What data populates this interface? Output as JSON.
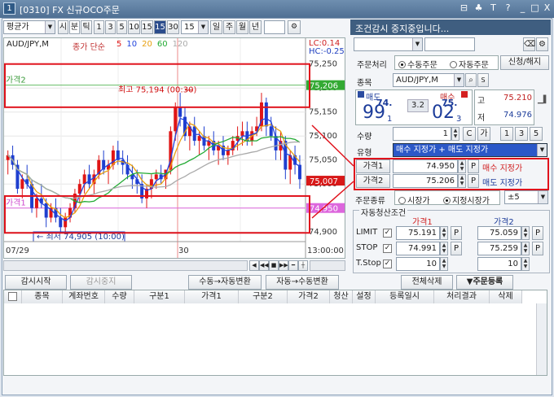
{
  "window": {
    "number": "1",
    "title": "[0310] FX 신규OCO주문",
    "controls": [
      "⊟",
      "♣",
      "T",
      "?",
      "_",
      "□",
      "X"
    ]
  },
  "toolbar": {
    "price_type": "평균가",
    "periods": [
      "시",
      "분",
      "틱",
      "1",
      "3",
      "5",
      "10",
      "15",
      "30"
    ],
    "active_period": "15",
    "period_value": "15",
    "units": [
      "일",
      "주",
      "월",
      "년"
    ]
  },
  "chart": {
    "symbol": "AUD/JPY,M",
    "indicator_label": "종가 단순",
    "ma_periods": [
      {
        "label": "5",
        "color": "#e01515"
      },
      {
        "label": "10",
        "color": "#2244dd"
      },
      {
        "label": "20",
        "color": "#e8a010"
      },
      {
        "label": "60",
        "color": "#22aa33"
      },
      {
        "label": "120",
        "color": "#aaaaaa"
      }
    ],
    "lc": "LC:0.14",
    "hc": "HC:-0.25",
    "y_ticks": [
      "75,250",
      "75,200",
      "75,150",
      "75,100",
      "75,050",
      "75,000",
      "74,950",
      "74,900"
    ],
    "price1_tag": "75,206",
    "current_tag": "75,007",
    "price2_tag": "74,950",
    "price2_line_label": "가격2",
    "price1_line_label": "가격1",
    "high_annotation": "최고 75,194 (00:30)",
    "low_annotation": "최저 74,905 (10:00)",
    "x_labels": [
      "07/29",
      "30",
      "13:00:00"
    ],
    "candles": [
      [
        75.05,
        75.07,
        75.02,
        75.06
      ],
      [
        75.06,
        75.08,
        75.03,
        75.04
      ],
      [
        75.04,
        75.05,
        74.98,
        74.99
      ],
      [
        74.99,
        75.02,
        74.97,
        75.01
      ],
      [
        75.01,
        75.04,
        74.99,
        75.0
      ],
      [
        75.0,
        75.01,
        74.94,
        74.95
      ],
      [
        74.95,
        74.98,
        74.93,
        74.97
      ],
      [
        74.97,
        75.0,
        74.95,
        74.96
      ],
      [
        74.96,
        74.97,
        74.91,
        74.93
      ],
      [
        74.93,
        74.96,
        74.92,
        74.95
      ],
      [
        74.95,
        74.97,
        74.92,
        74.93
      ],
      [
        74.93,
        74.95,
        74.9,
        74.91
      ],
      [
        74.91,
        74.94,
        74.9,
        74.93
      ],
      [
        74.93,
        74.96,
        74.92,
        74.95
      ],
      [
        74.95,
        74.99,
        74.94,
        74.98
      ],
      [
        74.98,
        75.01,
        74.96,
        75.0
      ],
      [
        75.0,
        75.03,
        74.98,
        75.02
      ],
      [
        75.02,
        75.04,
        74.99,
        75.0
      ],
      [
        75.0,
        75.03,
        74.98,
        75.02
      ],
      [
        75.02,
        75.06,
        75.01,
        75.05
      ],
      [
        75.05,
        75.07,
        75.02,
        75.03
      ],
      [
        75.03,
        75.05,
        75.0,
        75.04
      ],
      [
        75.04,
        75.08,
        75.03,
        75.07
      ],
      [
        75.07,
        75.09,
        75.04,
        75.05
      ],
      [
        75.05,
        75.07,
        75.02,
        75.04
      ],
      [
        75.04,
        75.06,
        75.01,
        75.02
      ],
      [
        75.02,
        75.04,
        74.99,
        75.01
      ],
      [
        75.01,
        75.03,
        74.98,
        75.0
      ],
      [
        75.0,
        75.02,
        74.96,
        74.97
      ],
      [
        74.97,
        75.0,
        74.95,
        74.99
      ],
      [
        74.99,
        75.02,
        74.97,
        75.01
      ],
      [
        75.01,
        75.03,
        74.99,
        75.02
      ],
      [
        75.02,
        75.04,
        75.0,
        75.01
      ],
      [
        75.01,
        75.03,
        74.99,
        75.03
      ],
      [
        75.03,
        75.12,
        75.02,
        75.11
      ],
      [
        75.11,
        75.17,
        75.09,
        75.16
      ],
      [
        75.16,
        75.19,
        75.12,
        75.14
      ],
      [
        75.14,
        75.16,
        75.09,
        75.1
      ],
      [
        75.1,
        75.13,
        75.07,
        75.12
      ],
      [
        75.12,
        75.14,
        75.08,
        75.09
      ],
      [
        75.09,
        75.11,
        75.06,
        75.1
      ],
      [
        75.1,
        75.12,
        75.07,
        75.08
      ],
      [
        75.08,
        75.1,
        75.05,
        75.09
      ],
      [
        75.09,
        75.11,
        75.06,
        75.07
      ],
      [
        75.07,
        75.09,
        75.04,
        75.08
      ],
      [
        75.08,
        75.1,
        75.05,
        75.06
      ],
      [
        75.06,
        75.08,
        75.04,
        75.07
      ],
      [
        75.07,
        75.1,
        75.06,
        75.09
      ],
      [
        75.09,
        75.12,
        75.07,
        75.1
      ],
      [
        75.1,
        75.13,
        75.08,
        75.11
      ],
      [
        75.11,
        75.13,
        75.08,
        75.09
      ],
      [
        75.09,
        75.12,
        75.08,
        75.11
      ],
      [
        75.11,
        75.14,
        75.1,
        75.12
      ],
      [
        75.12,
        75.19,
        75.11,
        75.17
      ],
      [
        75.17,
        75.18,
        75.1,
        75.12
      ],
      [
        75.12,
        75.14,
        75.09,
        75.1
      ],
      [
        75.1,
        75.12,
        75.05,
        75.07
      ],
      [
        75.07,
        75.11,
        75.05,
        75.09
      ],
      [
        75.09,
        75.1,
        75.01,
        75.03
      ],
      [
        75.03,
        75.07,
        75.0,
        75.06
      ],
      [
        75.06,
        75.08,
        75.02,
        75.04
      ],
      [
        75.04,
        75.06,
        74.99,
        75.01
      ]
    ]
  },
  "chart_nav": {
    "buttons": [
      "◀",
      "◀◀",
      "■",
      "▶▶",
      "━",
      "┼"
    ]
  },
  "actions": {
    "start_monitor": "감시시작",
    "stop_monitor": "감시중지",
    "manual_to_auto": "수동→자동변환",
    "auto_to_manual": "자동→수동변환",
    "delete_all": "전체삭제",
    "register_order": "▼주문등록"
  },
  "panel": {
    "status": "조건감시 중지중입니다...",
    "order_mode_label": "주문처리",
    "order_modes": [
      "수동주문",
      "자동주문"
    ],
    "order_mode_selected": "수동주문",
    "new_cancel": "신청/해지",
    "symbol_label": "종목",
    "symbol_value": "AUD/JPY,M",
    "sell_label": "매도",
    "buy_label": "매수",
    "sell_prefix": "74.",
    "sell_big": "99",
    "sell_sub": "1",
    "buy_prefix": "75.",
    "buy_big": "02",
    "buy_sub": "3",
    "spread": "3.2",
    "high_label": "고",
    "high_value": "75.210",
    "low_label": "저",
    "low_value": "74.976",
    "qty_label": "수량",
    "qty_value": "1",
    "qty_buttons": [
      "C",
      "가",
      "1",
      "3",
      "5"
    ],
    "type_label": "유형",
    "type_value": "매수 지정가 + 매도 지정가",
    "price1_label": "가격1",
    "price1_value": "74.950",
    "price1_desc": "매수 지정가",
    "price2_label": "가격2",
    "price2_value": "75.206",
    "price2_desc": "매도 지정가",
    "p_button": "P",
    "order_kind_label": "주문종류",
    "order_kinds": [
      "시장가",
      "지정시장가"
    ],
    "order_kind_selected": "지정시장가",
    "range": "±5",
    "settle_title": "자동청산조건",
    "col1": "가격1",
    "col2": "가격2",
    "rows": [
      {
        "label": "LIMIT",
        "v1": "75.191",
        "v2": "75.059"
      },
      {
        "label": "STOP",
        "v1": "74.991",
        "v2": "75.259"
      },
      {
        "label": "T.Stop",
        "v1": "10",
        "v2": "10"
      }
    ]
  },
  "grid": {
    "headers": [
      "종목",
      "계좌번호",
      "수량",
      "구분1",
      "가격1",
      "구분2",
      "가격2",
      "청산",
      "설정",
      "등록일시",
      "처리결과",
      "삭제"
    ]
  }
}
